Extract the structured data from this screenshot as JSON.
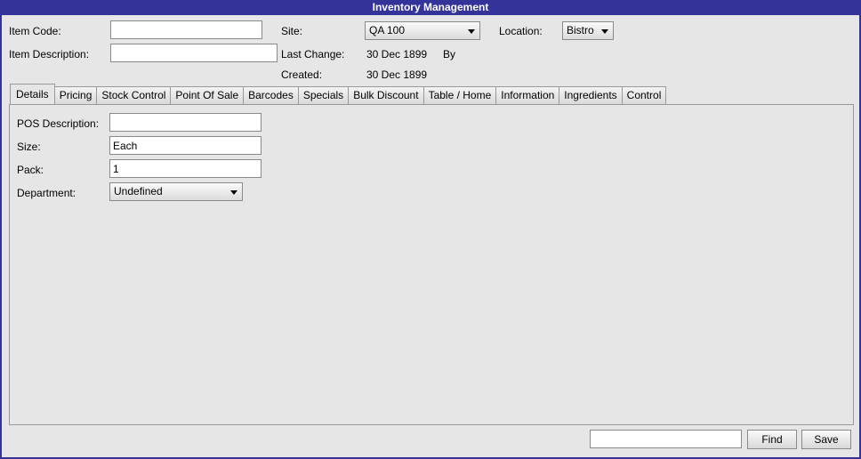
{
  "window": {
    "title": "Inventory Management"
  },
  "header": {
    "item_code_label": "Item Code:",
    "item_code_value": "",
    "item_description_label": "Item Description:",
    "item_description_value": "",
    "site_label": "Site:",
    "site_value": "QA 100",
    "location_label": "Location:",
    "location_value": "Bistro",
    "last_change_label": "Last Change:",
    "last_change_value": "30 Dec 1899",
    "by_label": "By",
    "created_label": "Created:",
    "created_value": "30 Dec 1899"
  },
  "tabs": [
    {
      "label": "Details",
      "active": true
    },
    {
      "label": "Pricing"
    },
    {
      "label": "Stock Control"
    },
    {
      "label": "Point Of Sale"
    },
    {
      "label": "Barcodes"
    },
    {
      "label": "Specials"
    },
    {
      "label": "Bulk Discount"
    },
    {
      "label": "Table / Home"
    },
    {
      "label": "Information"
    },
    {
      "label": "Ingredients"
    },
    {
      "label": "Control"
    }
  ],
  "details": {
    "pos_description_label": "POS Description:",
    "pos_description_value": "",
    "size_label": "Size:",
    "size_value": "Each",
    "pack_label": "Pack:",
    "pack_value": "1",
    "department_label": "Department:",
    "department_value": "Undefined"
  },
  "footer": {
    "find_input_value": "",
    "find_label": "Find",
    "save_label": "Save"
  }
}
